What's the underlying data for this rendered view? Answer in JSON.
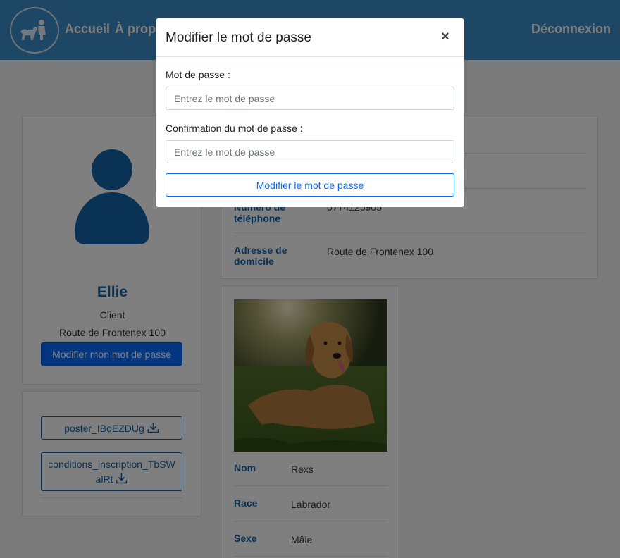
{
  "nav": {
    "home": "Accueil",
    "about": "À propos",
    "logout": "Déconnexion"
  },
  "profile": {
    "name": "Ellie",
    "role": "Client",
    "address": "Route de Frontenex 100",
    "change_password_button": "Modifier mon mot de passe"
  },
  "files": [
    {
      "name": "poster_IBoEZDUg"
    },
    {
      "name": "conditions_inscription_TbSWalRt"
    }
  ],
  "info": {
    "phone_label": "Numéro de téléphone",
    "phone_value": "0774125905",
    "address_label": "Adresse de domicile",
    "address_value": "Route de Frontenex 100"
  },
  "dog": {
    "rows": [
      {
        "label": "Nom",
        "value": "Rexs"
      },
      {
        "label": "Race",
        "value": "Labrador"
      },
      {
        "label": "Sexe",
        "value": "Mâle"
      }
    ]
  },
  "modal": {
    "title": "Modifier le mot de passe",
    "close": "×",
    "password_label": "Mot de passe :",
    "password_placeholder": "Entrez le mot de passe",
    "confirm_label": "Confirmation du mot de passe :",
    "confirm_placeholder": "Entrez le mot de passe",
    "submit": "Modifier le mot de passe"
  },
  "colors": {
    "navbar": "#3b8fc8",
    "primary": "#0d6efd",
    "label_blue": "#1565a8"
  },
  "icons": [
    "logo-icon",
    "user-avatar-icon",
    "download-icon",
    "close-icon"
  ]
}
